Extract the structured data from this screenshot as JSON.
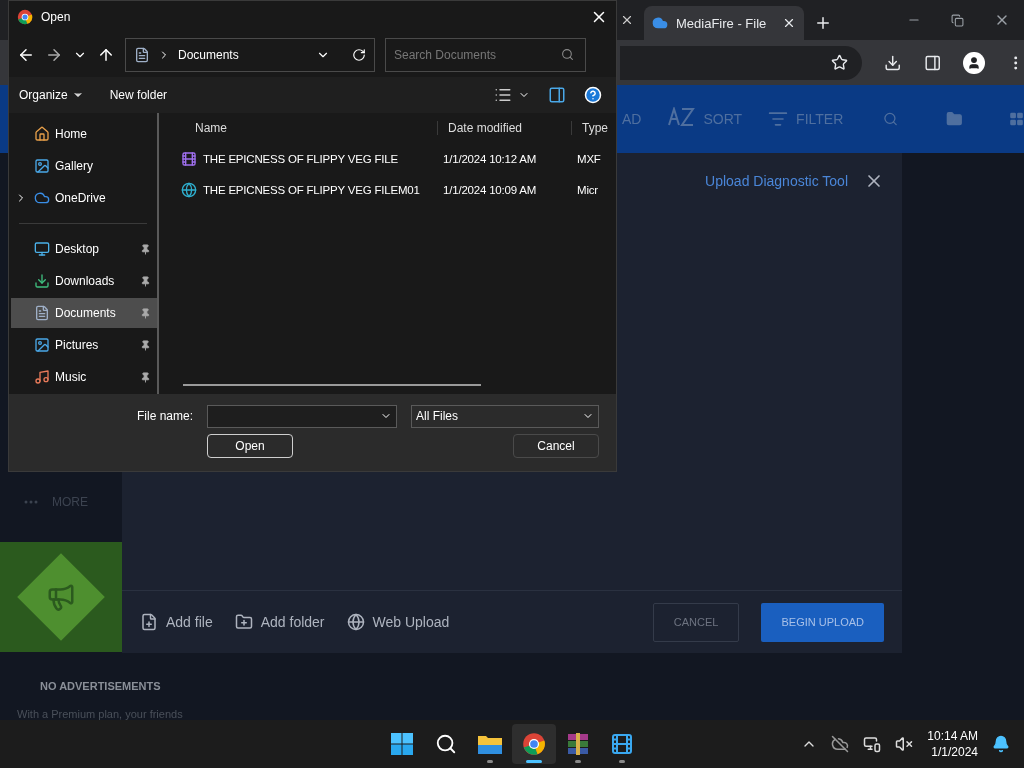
{
  "browser": {
    "tabs": [
      {
        "label": "MediaFire - File",
        "selected": true
      }
    ],
    "app_bar": [
      {
        "label": "AD",
        "kind": "text"
      },
      {
        "label": "SORT",
        "kind": "sort"
      },
      {
        "label": "FILTER",
        "kind": "filter"
      }
    ],
    "sidebar": {
      "more": "MORE",
      "ad_title": "NO ADVERTISEMENTS",
      "ad_text": "With a Premium plan, your friends"
    },
    "upload_modal": {
      "link": "Upload Diagnostic Tool",
      "actions": [
        {
          "label": "Add file",
          "kind": "file"
        },
        {
          "label": "Add folder",
          "kind": "folder"
        },
        {
          "label": "Web Upload",
          "kind": "web"
        }
      ],
      "buttons": [
        {
          "label": "CANCEL",
          "kind": "secondary"
        },
        {
          "label": "BEGIN UPLOAD",
          "kind": "primary"
        }
      ]
    }
  },
  "dialog": {
    "title": "Open",
    "address": "Documents",
    "search": {
      "placeholder": "Search Documents"
    },
    "commands": [
      {
        "label": "Organize",
        "kind": "menu"
      },
      {
        "label": "New folder",
        "kind": "plain"
      }
    ],
    "nav": [
      {
        "items": [
          {
            "label": "Home",
            "kind": "home",
            "selected": false,
            "pinned": false,
            "expandable": false
          },
          {
            "label": "Gallery",
            "kind": "gallery",
            "selected": false,
            "pinned": false,
            "expandable": false
          },
          {
            "label": "OneDrive",
            "kind": "cloud",
            "selected": false,
            "pinned": false,
            "expandable": true
          }
        ]
      },
      {
        "items": [
          {
            "label": "Desktop",
            "kind": "desktop",
            "selected": false,
            "pinned": true,
            "expandable": false
          },
          {
            "label": "Downloads",
            "kind": "downloads",
            "selected": false,
            "pinned": true,
            "expandable": false
          },
          {
            "label": "Documents",
            "kind": "documents",
            "selected": true,
            "pinned": true,
            "expandable": false
          },
          {
            "label": "Pictures",
            "kind": "pictures",
            "selected": false,
            "pinned": true,
            "expandable": false
          },
          {
            "label": "Music",
            "kind": "music",
            "selected": false,
            "pinned": true,
            "expandable": false
          }
        ]
      }
    ],
    "columns": [
      "Name",
      "Date modified",
      "Type"
    ],
    "files": [
      {
        "name": "THE EPICNESS OF FLIPPY VEG FILE",
        "date": "1/1/2024 10:12 AM",
        "type": "MXF",
        "kind": "video"
      },
      {
        "name": "THE EPICNESS OF FLIPPY VEG FILEM01",
        "date": "1/1/2024 10:09 AM",
        "type": "Micr",
        "kind": "edge"
      }
    ],
    "file_name_label": "File name:",
    "file_type": "All Files",
    "buttons": [
      {
        "label": "Open",
        "kind": "default"
      },
      {
        "label": "Cancel",
        "kind": "plain"
      }
    ]
  },
  "taskbar": {
    "apps": [
      {
        "kind": "start",
        "running": false,
        "selected": false
      },
      {
        "kind": "search",
        "running": false,
        "selected": false
      },
      {
        "kind": "explorer",
        "running": true,
        "selected": false
      },
      {
        "kind": "chrome",
        "running": true,
        "selected": true
      },
      {
        "kind": "archive",
        "running": true,
        "selected": false
      },
      {
        "kind": "video",
        "running": true,
        "selected": false
      }
    ],
    "time": "10:14 AM",
    "date": "1/1/2024"
  }
}
